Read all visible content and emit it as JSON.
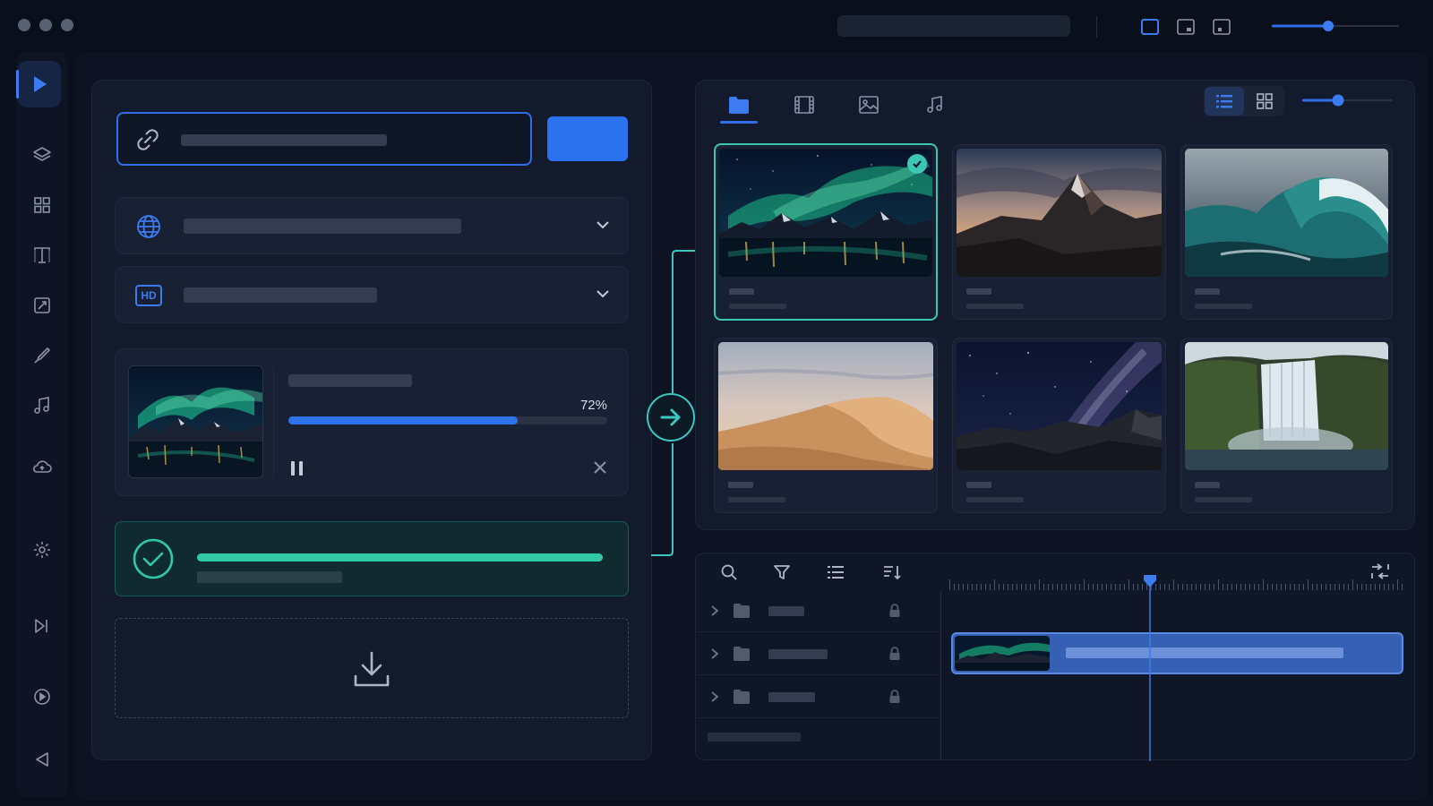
{
  "window": {
    "title": ""
  },
  "colors": {
    "accent": "#2f6ee8",
    "success": "#2fc9a8",
    "teal": "#3cc6b4",
    "bg": "#0a0f1c"
  },
  "sidebar": {
    "items": [
      {
        "icon": "play-icon",
        "active": true
      },
      {
        "icon": "layers-icon"
      },
      {
        "icon": "grid-icon"
      },
      {
        "icon": "text-icon"
      },
      {
        "icon": "image-edit-icon"
      },
      {
        "icon": "brush-icon"
      },
      {
        "icon": "music-icon"
      },
      {
        "icon": "cloud-icon"
      },
      {
        "icon": "gear-icon"
      },
      {
        "icon": "export-icon"
      },
      {
        "icon": "play-circle-icon"
      },
      {
        "icon": "back-icon"
      }
    ]
  },
  "download": {
    "url_placeholder": "",
    "progress": {
      "percent_label": "72%",
      "fraction": 0.72
    },
    "quality_badge": "HD",
    "completed_fraction": 1.0
  },
  "media": {
    "tabs": [
      "folder-icon",
      "film-icon",
      "image-icon",
      "music-icon"
    ],
    "active_tab": 0,
    "view": "list",
    "items": [
      {
        "subject": "aurora",
        "selected": true
      },
      {
        "subject": "mountain"
      },
      {
        "subject": "wave"
      },
      {
        "subject": "dunes"
      },
      {
        "subject": "milky-way"
      },
      {
        "subject": "waterfall"
      }
    ]
  },
  "timeline": {
    "tools": [
      "search-icon",
      "filter-icon",
      "list-icon",
      "sort-icon"
    ],
    "tracks": 3
  }
}
